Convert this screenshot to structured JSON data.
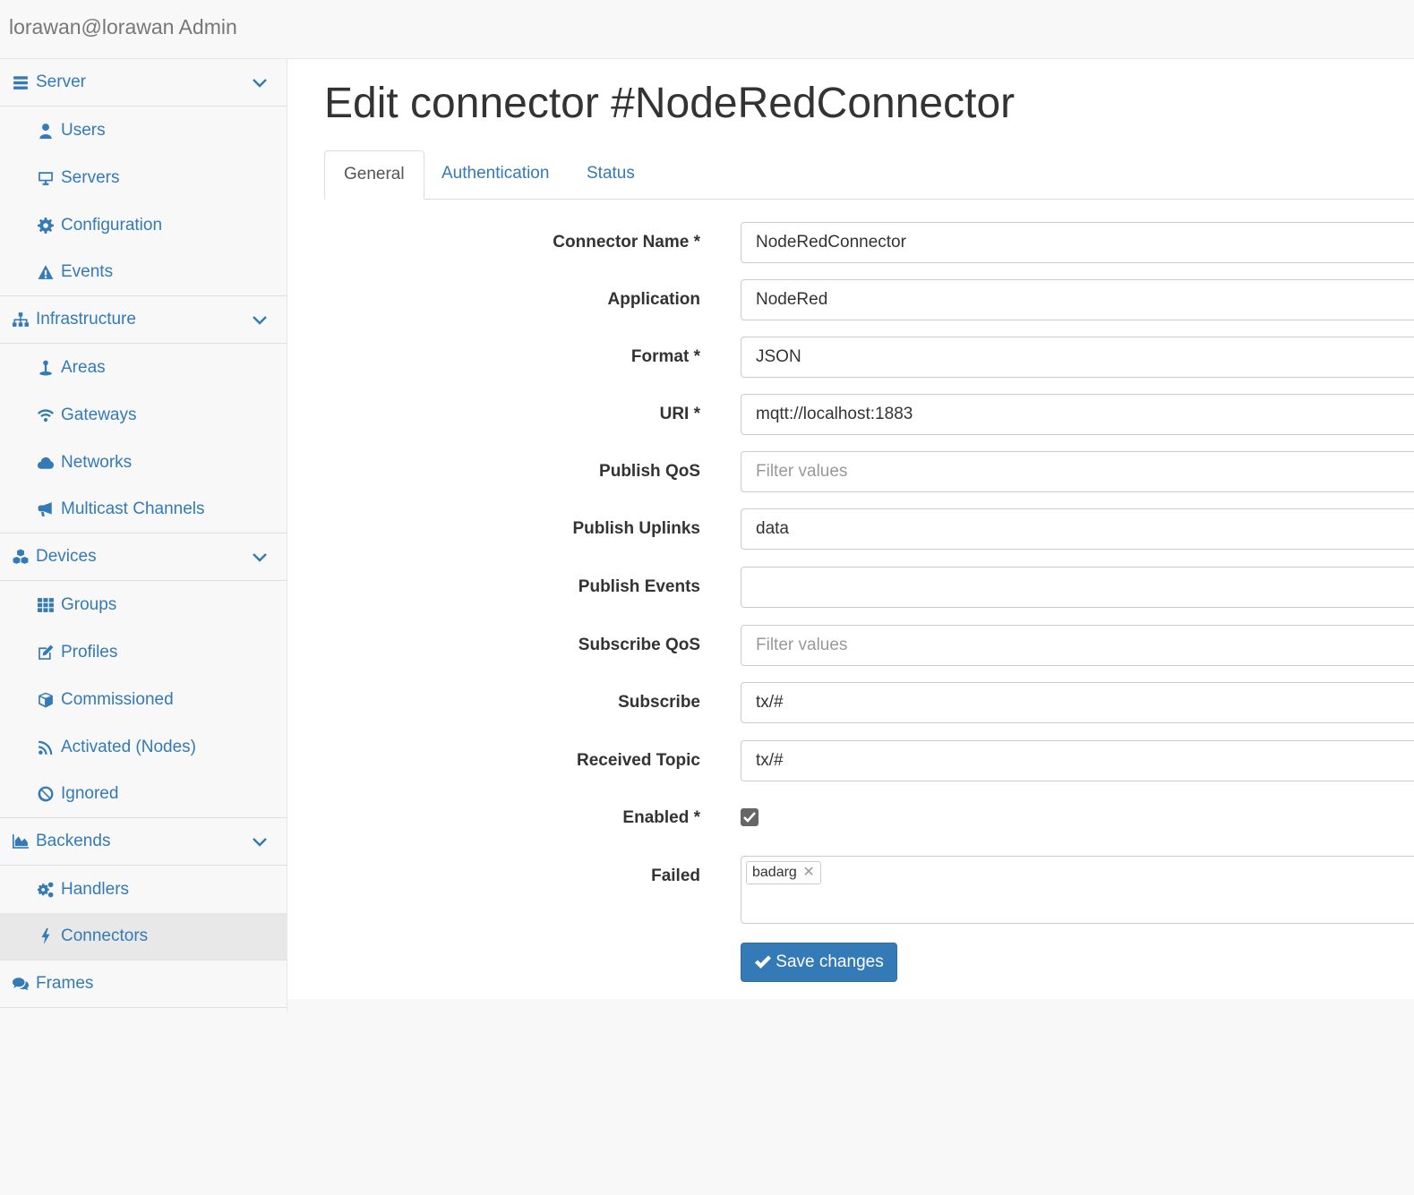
{
  "header": {
    "brand": "lorawan@lorawan Admin"
  },
  "sidebar": {
    "sections": [
      {
        "label": "Server",
        "icon": "server-icon",
        "items": [
          {
            "label": "Users",
            "icon": "user-icon"
          },
          {
            "label": "Servers",
            "icon": "desktop-icon"
          },
          {
            "label": "Configuration",
            "icon": "gear-icon"
          },
          {
            "label": "Events",
            "icon": "warning-icon"
          }
        ]
      },
      {
        "label": "Infrastructure",
        "icon": "sitemap-icon",
        "items": [
          {
            "label": "Areas",
            "icon": "map-pin-icon"
          },
          {
            "label": "Gateways",
            "icon": "wifi-icon"
          },
          {
            "label": "Networks",
            "icon": "cloud-icon"
          },
          {
            "label": "Multicast Channels",
            "icon": "bullhorn-icon"
          }
        ]
      },
      {
        "label": "Devices",
        "icon": "cubes-icon",
        "items": [
          {
            "label": "Groups",
            "icon": "grid-icon"
          },
          {
            "label": "Profiles",
            "icon": "edit-icon"
          },
          {
            "label": "Commissioned",
            "icon": "cube-icon"
          },
          {
            "label": "Activated (Nodes)",
            "icon": "rss-icon"
          },
          {
            "label": "Ignored",
            "icon": "ban-icon"
          }
        ]
      },
      {
        "label": "Backends",
        "icon": "area-chart-icon",
        "items": [
          {
            "label": "Handlers",
            "icon": "gears-icon"
          },
          {
            "label": "Connectors",
            "icon": "bolt-icon",
            "active": true
          }
        ]
      },
      {
        "label": "Frames",
        "icon": "comments-icon",
        "items": []
      }
    ]
  },
  "main": {
    "title": "Edit connector #NodeRedConnector",
    "tabs": [
      {
        "label": "General",
        "active": true
      },
      {
        "label": "Authentication"
      },
      {
        "label": "Status"
      }
    ],
    "form": {
      "connector_name": {
        "label": "Connector Name *",
        "value": "NodeRedConnector"
      },
      "application": {
        "label": "Application",
        "value": "NodeRed"
      },
      "format": {
        "label": "Format *",
        "value": "JSON"
      },
      "uri": {
        "label": "URI *",
        "value": "mqtt://localhost:1883"
      },
      "publish_qos": {
        "label": "Publish QoS",
        "value": "",
        "placeholder": "Filter values"
      },
      "publish_uplinks": {
        "label": "Publish Uplinks",
        "value": "data"
      },
      "publish_events": {
        "label": "Publish Events",
        "value": ""
      },
      "subscribe_qos": {
        "label": "Subscribe QoS",
        "value": "",
        "placeholder": "Filter values"
      },
      "subscribe": {
        "label": "Subscribe",
        "value": "tx/#"
      },
      "received_topic": {
        "label": "Received Topic",
        "value": "tx/#"
      },
      "enabled": {
        "label": "Enabled *",
        "checked": true
      },
      "failed": {
        "label": "Failed",
        "tags": [
          "badarg"
        ]
      }
    },
    "save_label": "Save changes"
  },
  "colors": {
    "link": "#337ab7",
    "button": "#337ab7"
  }
}
